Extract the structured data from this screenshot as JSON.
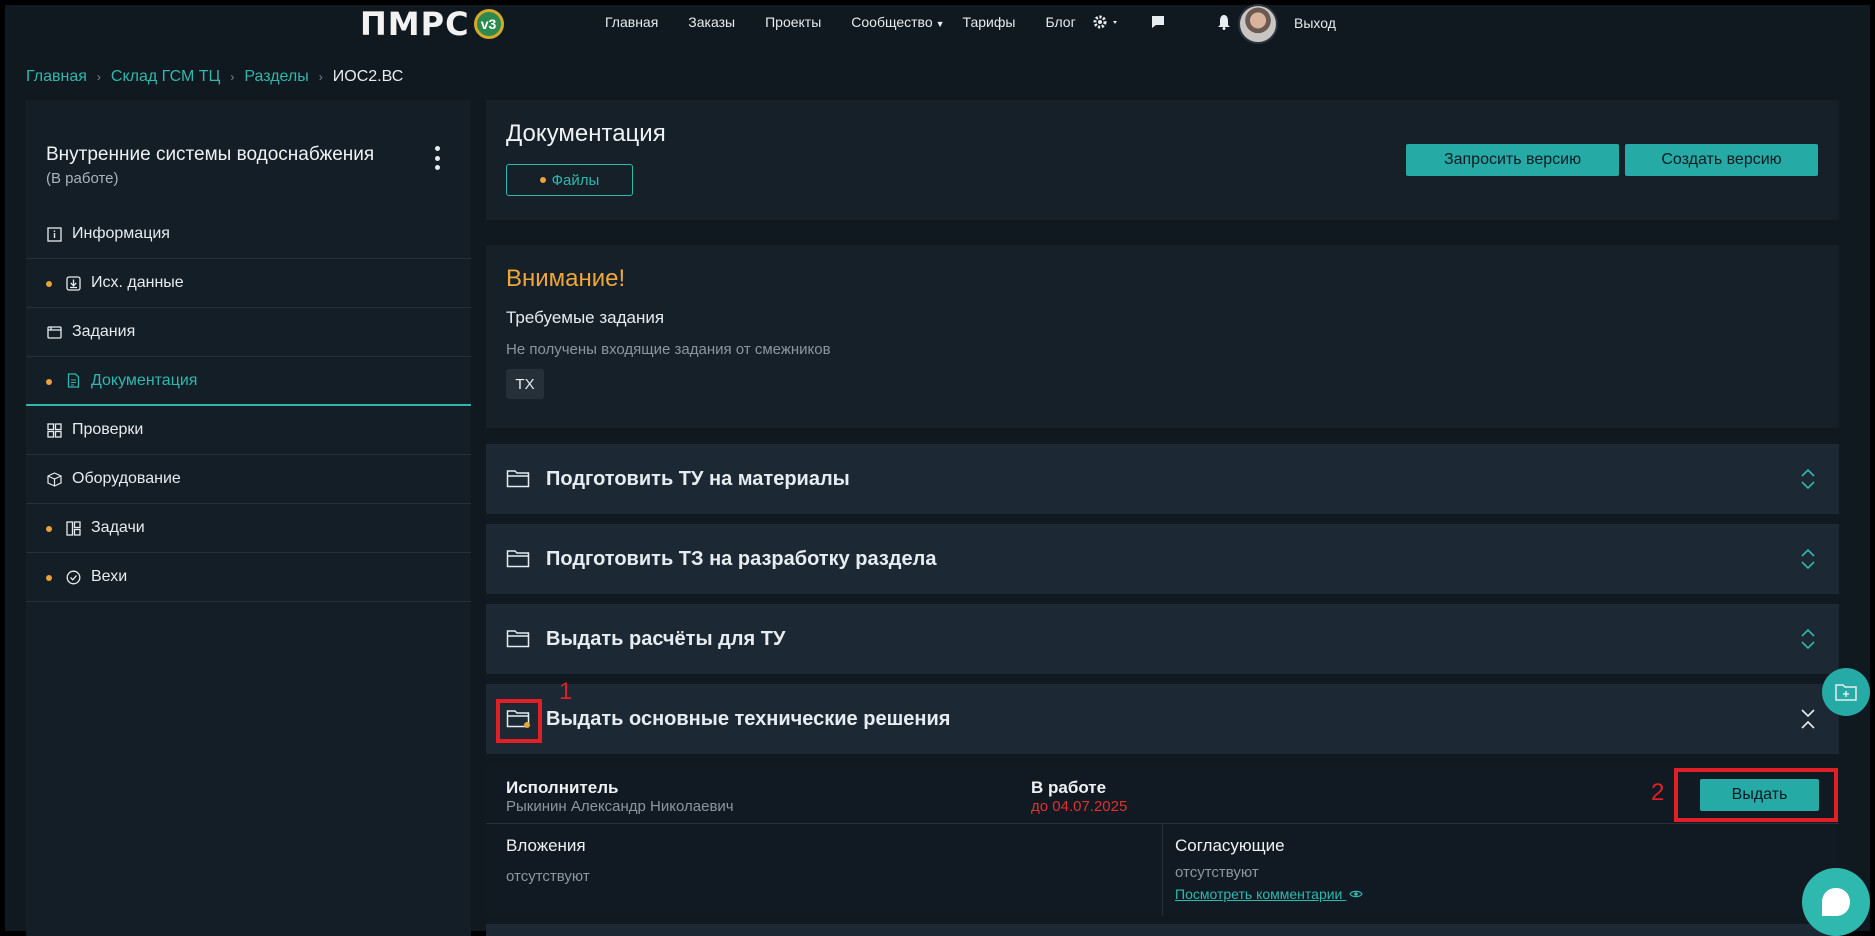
{
  "nav": {
    "logo_text": "ПМРС",
    "logo_badge": "v3",
    "links": [
      "Главная",
      "Заказы",
      "Проекты",
      "Сообщество",
      "Тарифы",
      "Блог"
    ],
    "logout": "Выход",
    "icons": [
      "gear-icon",
      "chat-icon",
      "bell-icon"
    ]
  },
  "breadcrumb": {
    "items": [
      "Главная",
      "Склад ГСМ ТЦ",
      "Разделы"
    ],
    "current": "ИОС2.ВС"
  },
  "sidebar": {
    "title": "Внутренние системы водоснабжения",
    "status": "(В работе)",
    "items": [
      {
        "label": "Информация",
        "icon": "info-icon",
        "dot": false,
        "active": false
      },
      {
        "label": "Исх. данные",
        "icon": "download-icon",
        "dot": true,
        "active": false
      },
      {
        "label": "Задания",
        "icon": "tasks-window-icon",
        "dot": false,
        "active": false
      },
      {
        "label": "Документация",
        "icon": "document-icon",
        "dot": true,
        "active": true
      },
      {
        "label": "Проверки",
        "icon": "grid-icon",
        "dot": false,
        "active": false
      },
      {
        "label": "Оборудование",
        "icon": "box-icon",
        "dot": false,
        "active": false
      },
      {
        "label": "Задачи",
        "icon": "board-icon",
        "dot": true,
        "active": false
      },
      {
        "label": "Вехи",
        "icon": "check-circle-icon",
        "dot": true,
        "active": false
      }
    ]
  },
  "docs": {
    "title": "Документация",
    "files_tab": "Файлы",
    "request_btn": "Запросить версию",
    "create_btn": "Создать версию"
  },
  "warning": {
    "title": "Внимание!",
    "subtitle": "Требуемые задания",
    "text": "Не получены входящие задания от смежников",
    "tag": "ТХ"
  },
  "accordion": [
    {
      "label": "Подготовить ТУ на материалы",
      "expanded": false
    },
    {
      "label": "Подготовить ТЗ на разработку раздела",
      "expanded": false
    },
    {
      "label": "Выдать расчёты для ТУ",
      "expanded": false
    },
    {
      "label": "Выдать основные технические решения",
      "expanded": true
    }
  ],
  "markers": [
    "1",
    "2"
  ],
  "detail": {
    "executor_label": "Исполнитель",
    "executor_name": "Рыкинин Александр Николаевич",
    "status_label": "В работе",
    "deadline": "до 04.07.2025",
    "issue_btn": "Выдать",
    "attachments_label": "Вложения",
    "attachments_value": "отсутствуют",
    "approvers_label": "Согласующие",
    "approvers_value": "отсутствуют",
    "comments_link": "Посмотреть комментарии"
  },
  "colors": {
    "accent": "#26aaa5",
    "warning": "#f0a63a",
    "dot": "#e8a33a",
    "deadline": "#e0302f",
    "marker": "#e01f26"
  }
}
